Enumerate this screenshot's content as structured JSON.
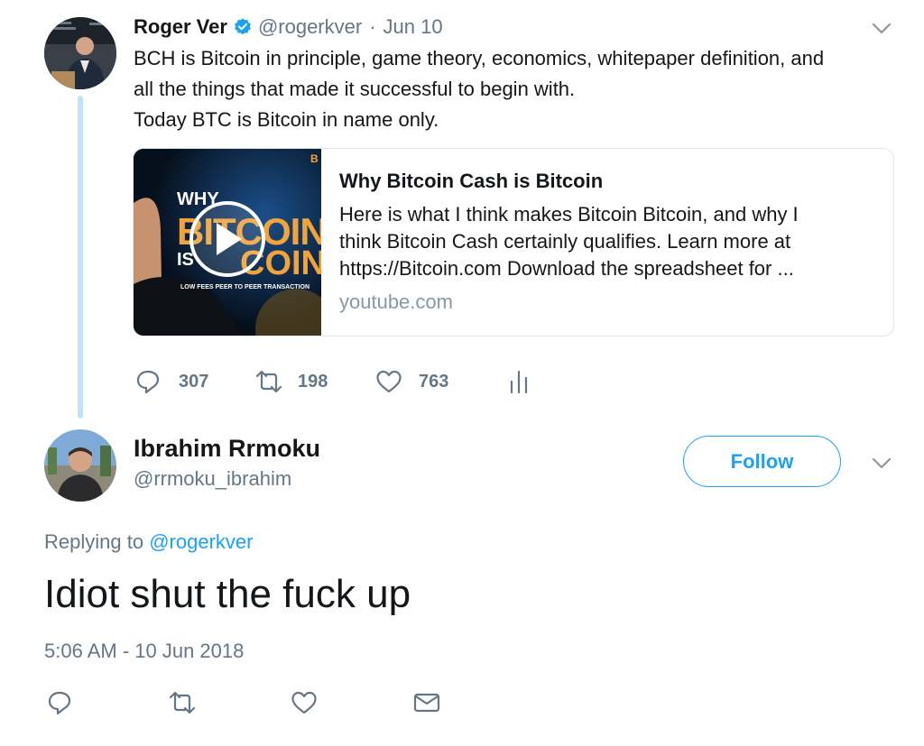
{
  "parent_tweet": {
    "author_name": "Roger Ver",
    "handle": "@rogerkver",
    "separator": "·",
    "date": "Jun 10",
    "text_line1": "BCH is Bitcoin in principle, game theory, economics, whitepaper definition, and",
    "text_line2": "all the things that made it successful to begin with.",
    "text_line3": "Today BTC is Bitcoin in name only.",
    "card": {
      "title": "Why Bitcoin Cash is Bitcoin",
      "desc_line1": "Here is what I think makes Bitcoin Bitcoin, and why I",
      "desc_line2": "think Bitcoin Cash certainly qualifies. Learn more at",
      "desc_line3": "https://Bitcoin.com Download the spreadsheet for ...",
      "domain": "youtube.com",
      "thumb_text_why": "WHY",
      "thumb_text_bitcoin": "BITCOIN C",
      "thumb_text_is": "IS",
      "thumb_text_coin": "COIN",
      "thumb_caption": "LOW FEES  PEER TO PEER TRANSACTION",
      "thumb_corner": "B"
    },
    "stats": {
      "replies": "307",
      "retweets": "198",
      "likes": "763"
    }
  },
  "reply_tweet": {
    "author_name": "Ibrahim Rrmoku",
    "handle": "@rrmoku_ibrahim",
    "follow_label": "Follow",
    "replying_prefix": "Replying to",
    "replying_handle": "@rogerkver",
    "text": "Idiot shut the fuck up",
    "timestamp": "5:06 AM - 10 Jun 2018"
  },
  "colors": {
    "accent": "#1da1f2",
    "muted": "#657786",
    "thread_line": "#c4e2f6",
    "verified": "#1da1f2"
  },
  "icons": {
    "reply": "reply-icon",
    "retweet": "retweet-icon",
    "like": "heart-icon",
    "analytics": "analytics-icon",
    "dm": "envelope-icon",
    "more": "chevron-down-icon",
    "verified": "verified-badge-icon",
    "play": "play-icon"
  }
}
